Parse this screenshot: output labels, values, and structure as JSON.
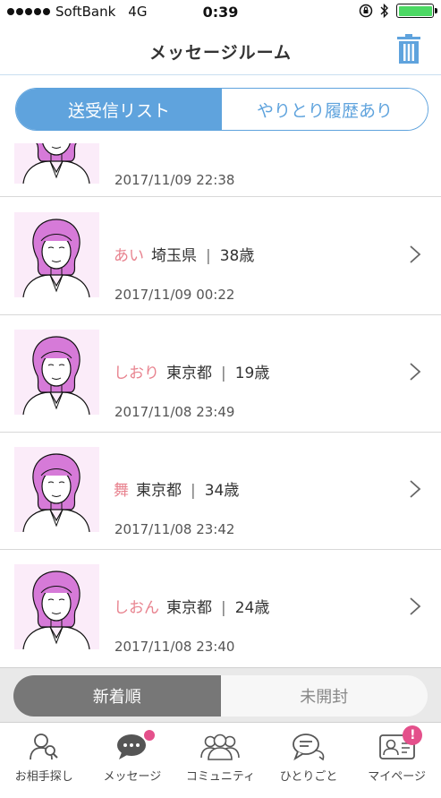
{
  "status_bar": {
    "carrier": "SoftBank",
    "network": "4G",
    "time": "0:39"
  },
  "header": {
    "title": "メッセージルーム",
    "trash_icon": "trash-icon"
  },
  "top_tabs": [
    {
      "label": "送受信リスト",
      "active": true
    },
    {
      "label": "やりとり履歴あり",
      "active": false
    }
  ],
  "messages": [
    {
      "name": "",
      "prefecture": "",
      "age": "",
      "date": "2017/11/09 22:38"
    },
    {
      "name": "あい",
      "prefecture": "埼玉県",
      "age": "38歳",
      "date": "2017/11/09 00:22"
    },
    {
      "name": "しおり",
      "prefecture": "東京都",
      "age": "19歳",
      "date": "2017/11/08 23:49"
    },
    {
      "name": "舞",
      "prefecture": "東京都",
      "age": "34歳",
      "date": "2017/11/08 23:42"
    },
    {
      "name": "しおん",
      "prefecture": "東京都",
      "age": "24歳",
      "date": "2017/11/08 23:40"
    }
  ],
  "separator": "|",
  "sort_tabs": [
    {
      "label": "新着順",
      "active": true
    },
    {
      "label": "未開封",
      "active": false
    }
  ],
  "tabbar": [
    {
      "label": "お相手探し",
      "icon": "search-person-icon"
    },
    {
      "label": "メッセージ",
      "icon": "chat-bubble-icon"
    },
    {
      "label": "コミュニティ",
      "icon": "community-icon"
    },
    {
      "label": "ひとりごと",
      "icon": "monologue-icon"
    },
    {
      "label": "マイページ",
      "icon": "profile-card-icon",
      "badge": "!"
    }
  ],
  "colors": {
    "accent": "#5fa3dd",
    "name": "#e8838f",
    "badge": "#e4508b"
  }
}
